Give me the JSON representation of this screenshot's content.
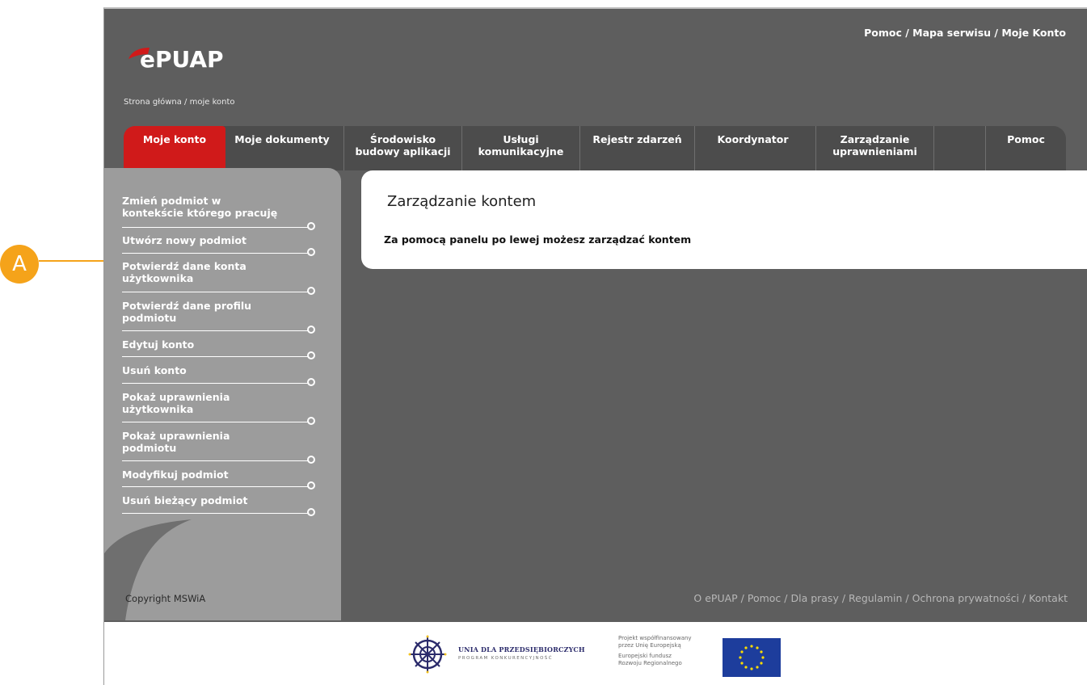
{
  "header": {
    "logo_text": "ePUAP",
    "breadcrumb": "Strona główna / moje konto",
    "top_links": [
      "Pomoc",
      "Mapa serwisu",
      "Moje Konto"
    ]
  },
  "tabs": [
    {
      "label": "Moje konto",
      "active": true
    },
    {
      "label": "Moje dokumenty"
    },
    {
      "label": "Środowisko\nbudowy aplikacji"
    },
    {
      "label": "Usługi\nkomunikacyjne"
    },
    {
      "label": "Rejestr zdarzeń"
    },
    {
      "label": "Koordynator"
    },
    {
      "label": "Zarządzanie\nuprawnieniami"
    },
    {
      "label": ""
    },
    {
      "label": "Pomoc"
    }
  ],
  "sidebar": {
    "items": [
      {
        "label": "Zmień podmiot w\nkontekście którego pracuję"
      },
      {
        "label": "Utwórz nowy podmiot"
      },
      {
        "label": "Potwierdź dane konta\nużytkownika"
      },
      {
        "label": "Potwierdź dane profilu\npodmiotu"
      },
      {
        "label": "Edytuj konto"
      },
      {
        "label": "Usuń konto"
      },
      {
        "label": "Pokaż uprawnienia\nużytkownika"
      },
      {
        "label": "Pokaż uprawnienia\npodmiotu"
      },
      {
        "label": "Modyfikuj podmiot"
      },
      {
        "label": "Usuń bieżący podmiot"
      }
    ],
    "copyright": "Copyright MSWiA"
  },
  "main": {
    "title": "Zarządzanie kontem",
    "text": "Za pomocą panelu po lewej możesz zarządzać kontem"
  },
  "footer": {
    "links": [
      "O ePUAP",
      "Pomoc",
      "Dla prasy",
      "Regulamin",
      "Ochrona prywatności",
      "Kontakt"
    ],
    "unia_title": "UNIA DLA PRZEDSIĘBIORCZYCH",
    "unia_subtitle": "PROGRAM KONKURENCYJNOŚĆ",
    "eu_text_1": "Projekt współfinansowany\nprzez Unię Europejską",
    "eu_text_2": "Europejski fundusz\nRozwoju Regionalnego"
  },
  "annotation": {
    "marker_label": "A"
  },
  "colors": {
    "accent_red": "#d01a1a",
    "marker_orange": "#f5a31a",
    "background_dark": "#5e5e5e",
    "sidebar_gray": "#9c9c9c"
  }
}
